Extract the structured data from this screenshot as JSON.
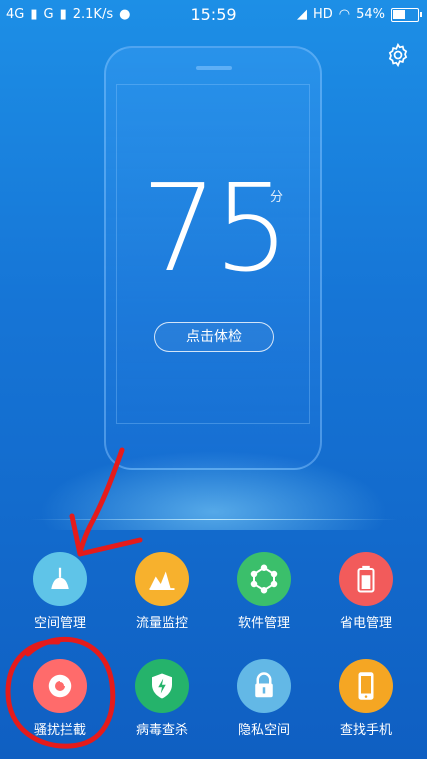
{
  "status_bar": {
    "net1": "4G",
    "net2": "G",
    "speed": "2.1K/s",
    "time": "15:59",
    "hd": "HD",
    "battery": "54%",
    "battery_level": 0.54
  },
  "score": {
    "value": "75",
    "unit": "分",
    "check_button": "点击体检"
  },
  "tiles": [
    {
      "label": "空间管理",
      "icon": "broom-icon",
      "color": "#5fc4e8"
    },
    {
      "label": "流量监控",
      "icon": "data-chart-icon",
      "color": "#f7b12d"
    },
    {
      "label": "软件管理",
      "icon": "hexagon-nodes-icon",
      "color": "#3bbf6b"
    },
    {
      "label": "省电管理",
      "icon": "battery-icon",
      "color": "#f25b5b"
    },
    {
      "label": "骚扰拦截",
      "icon": "block-icon",
      "color": "#ff6b6b"
    },
    {
      "label": "病毒查杀",
      "icon": "shield-bolt-icon",
      "color": "#25b36b"
    },
    {
      "label": "隐私空间",
      "icon": "lock-icon",
      "color": "#63b8e6"
    },
    {
      "label": "查找手机",
      "icon": "phone-icon",
      "color": "#f5a623"
    }
  ]
}
